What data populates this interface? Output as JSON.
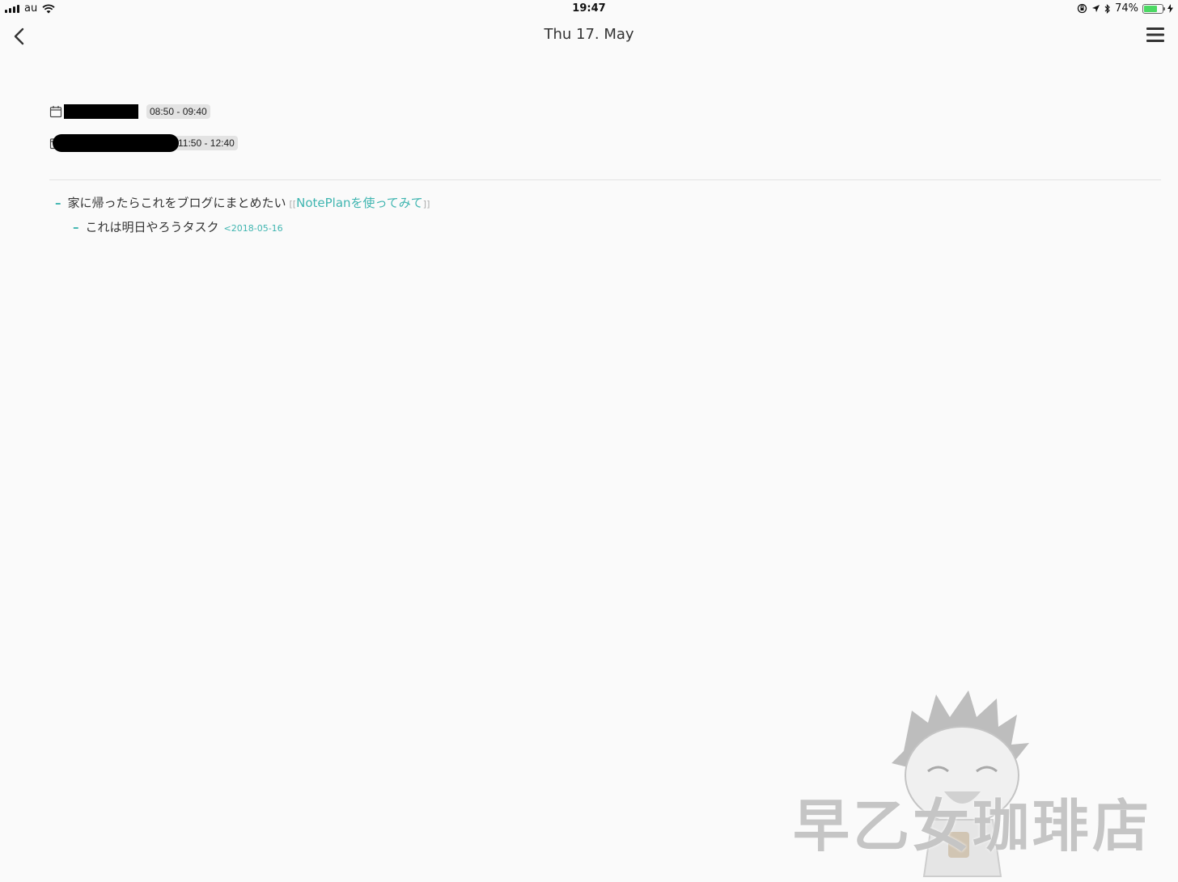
{
  "status_bar": {
    "carrier": "au",
    "time": "19:47",
    "battery_percent": "74%",
    "battery_level": 0.74
  },
  "nav": {
    "title": "Thu 17. May"
  },
  "events": [
    {
      "time": "08:50 - 09:40"
    },
    {
      "time": "11:50 - 12:40"
    }
  ],
  "tasks": [
    {
      "text": "家に帰ったらこれをブログにまとめたい",
      "link_open": "[[",
      "link": "NotePlanを使ってみて",
      "link_close": "]]"
    },
    {
      "text": "これは明日やろうタスク",
      "date_tag": "<2018-05-16"
    }
  ],
  "watermark": {
    "text": "早乙女珈琲店"
  },
  "colors": {
    "accent": "#3fb5b0",
    "background": "#fafafa",
    "badge": "#e3e3e3"
  }
}
